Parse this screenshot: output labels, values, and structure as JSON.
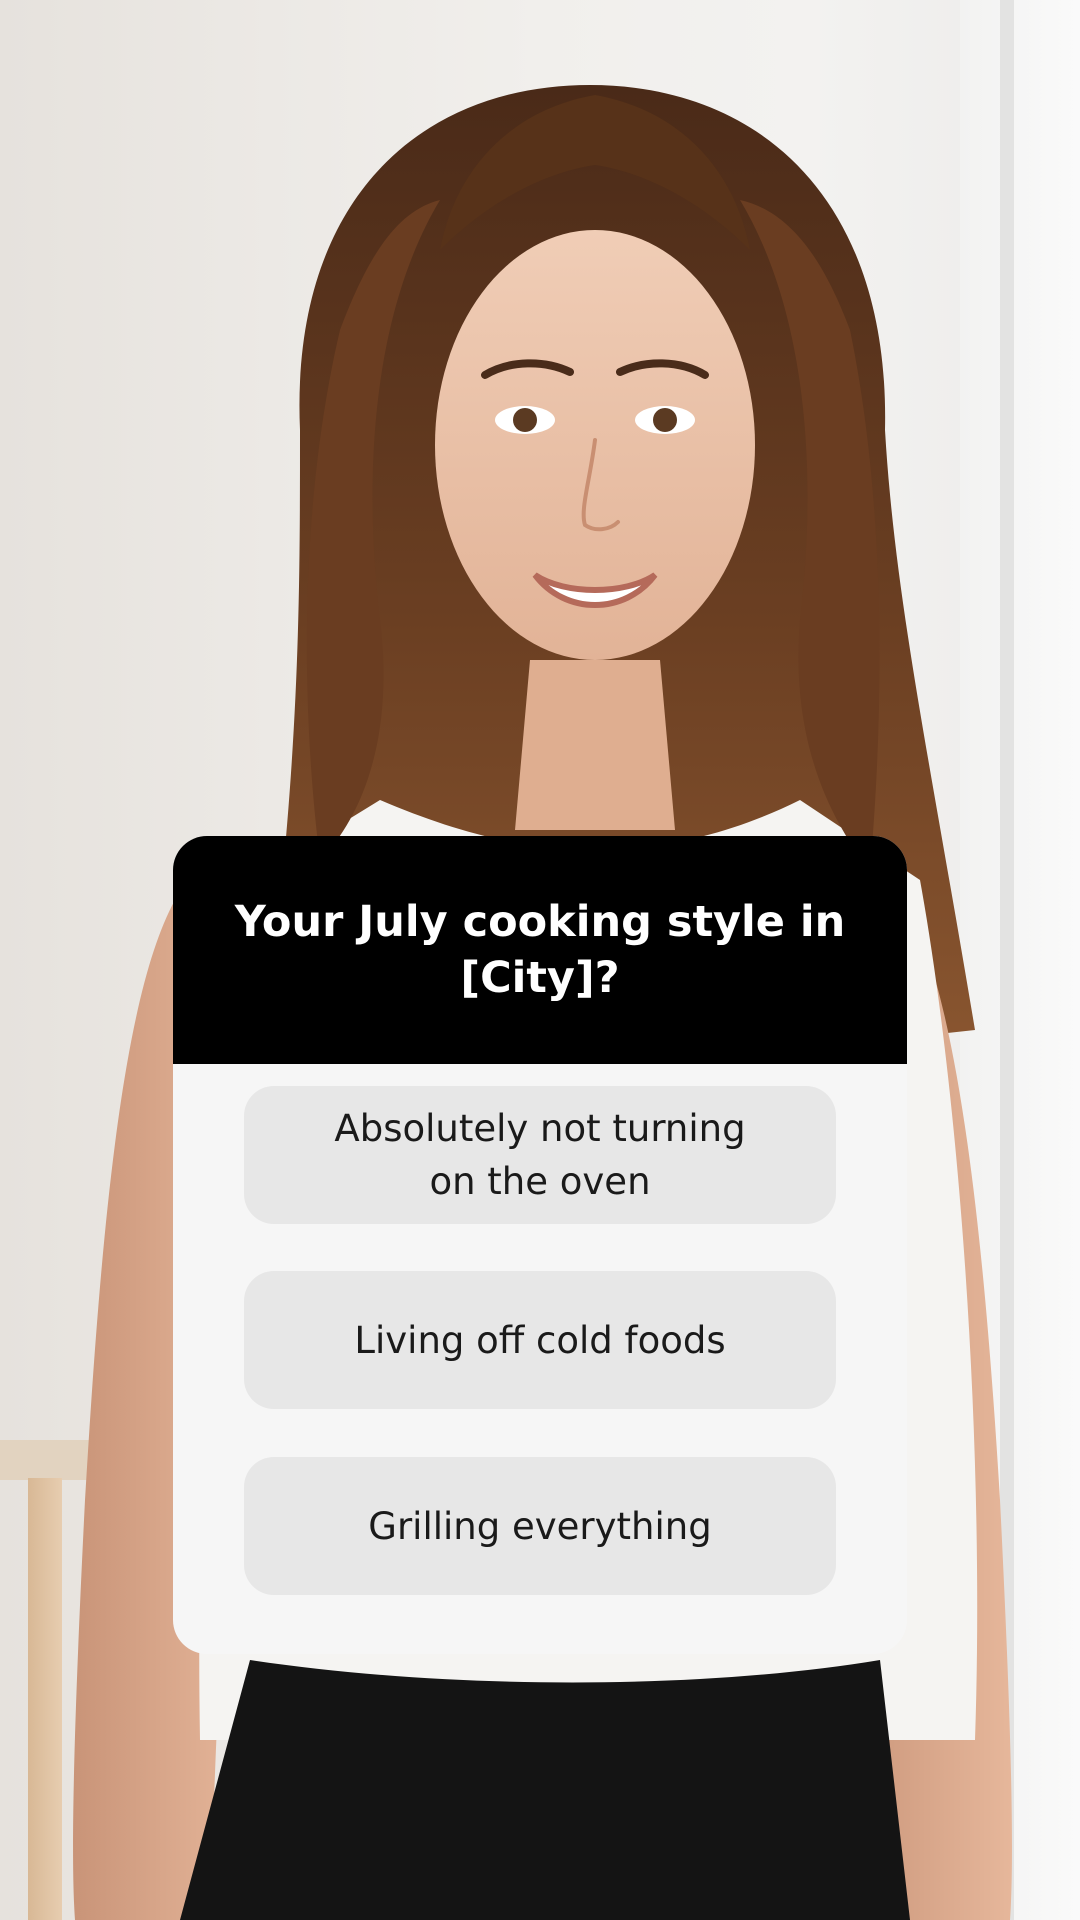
{
  "poll": {
    "question": "Your July cooking style in\n[City]?",
    "options": [
      {
        "label": "Absolutely not turning\non the oven"
      },
      {
        "label": "Living off cold foods"
      },
      {
        "label": "Grilling everything"
      }
    ]
  },
  "colors": {
    "header_background": "#000000",
    "card_background": "#f6f6f6",
    "option_background": "#e7e7e7",
    "question_text": "#ffffff",
    "option_text": "#1a1a1a"
  }
}
